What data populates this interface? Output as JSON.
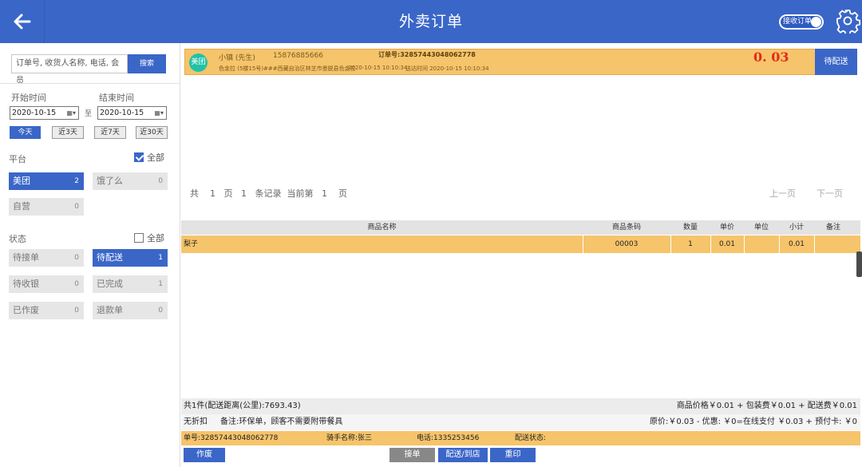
{
  "header": {
    "title": "外卖订单",
    "toggle_label": "接收订单"
  },
  "search": {
    "placeholder": "订单号, 收货人名称, 电话, 会员",
    "button": "搜索"
  },
  "dates": {
    "start_label": "开始时间",
    "end_label": "结束时间",
    "start": "2020-10-15",
    "end": "2020-10-15",
    "sep": "至",
    "calendar_glyph": "▦▾"
  },
  "quick": [
    "今天",
    "近3天",
    "近7天",
    "近30天"
  ],
  "platform": {
    "label": "平台",
    "all": "全部",
    "items": [
      {
        "name": "美团",
        "count": "2"
      },
      {
        "name": "饿了么",
        "count": "0"
      },
      {
        "name": "自营",
        "count": "0"
      }
    ]
  },
  "status": {
    "label": "状态",
    "all": "全部",
    "items": [
      {
        "name": "待接单",
        "count": "0"
      },
      {
        "name": "待配送",
        "count": "1"
      },
      {
        "name": "待收银",
        "count": "0"
      },
      {
        "name": "已完成",
        "count": "1"
      },
      {
        "name": "已作废",
        "count": "0"
      },
      {
        "name": "退款单",
        "count": "0"
      }
    ]
  },
  "order": {
    "badge": "美团",
    "customer": "小镇 (先生)",
    "phone": "15876885666",
    "order_no": "订单号:32857443048062778",
    "address": "色金拉 (5楼15号)###西藏自治区林芝市墨脱县色金拉",
    "time": "2020-10-15 10:10:34",
    "arrive": "送达时间 2020-10-15 10:10:34",
    "amount": "0. 03",
    "status_button": "待配送"
  },
  "pager": {
    "total_pre": "共",
    "pages": "1",
    "page_unit": "页",
    "records": "1",
    "records_unit": "条记录",
    "current_pre": "当前第",
    "current": "1",
    "current_unit": "页",
    "prev": "上一页",
    "next": "下一页"
  },
  "table": {
    "headers": [
      "商品名称",
      "商品条码",
      "数量",
      "单价",
      "单位",
      "小计",
      "备注"
    ],
    "rows": [
      [
        "梨子",
        "00003",
        "1",
        "0.01",
        "",
        "0.01",
        ""
      ]
    ]
  },
  "summary": {
    "count_line": "共1件(配送距离(公里):7693.43)",
    "price_line": "商品价格￥0.01 + 包装费￥0.01 + 配送费￥0.01",
    "discount": "无折扣",
    "note": "备注:环保单，顾客不需要附带餐具",
    "pay_line": "原价:￥0.03 - 优惠: ￥0=在线支付 ￥0.03 + 预付卡: ￥0"
  },
  "delivery": {
    "order_no": "单号:32857443048062778",
    "rider": "骑手名称:张三",
    "phone": "电话:1335253456",
    "state": "配送状态:"
  },
  "actions": {
    "void": "作废",
    "accept": "接单",
    "deliver": "配送/到店",
    "reprint": "重印"
  },
  "colors": {
    "primary": "#3a66c8",
    "highlight": "#f6c46a",
    "amount": "#e22c1c",
    "badge": "#20c2a6"
  }
}
